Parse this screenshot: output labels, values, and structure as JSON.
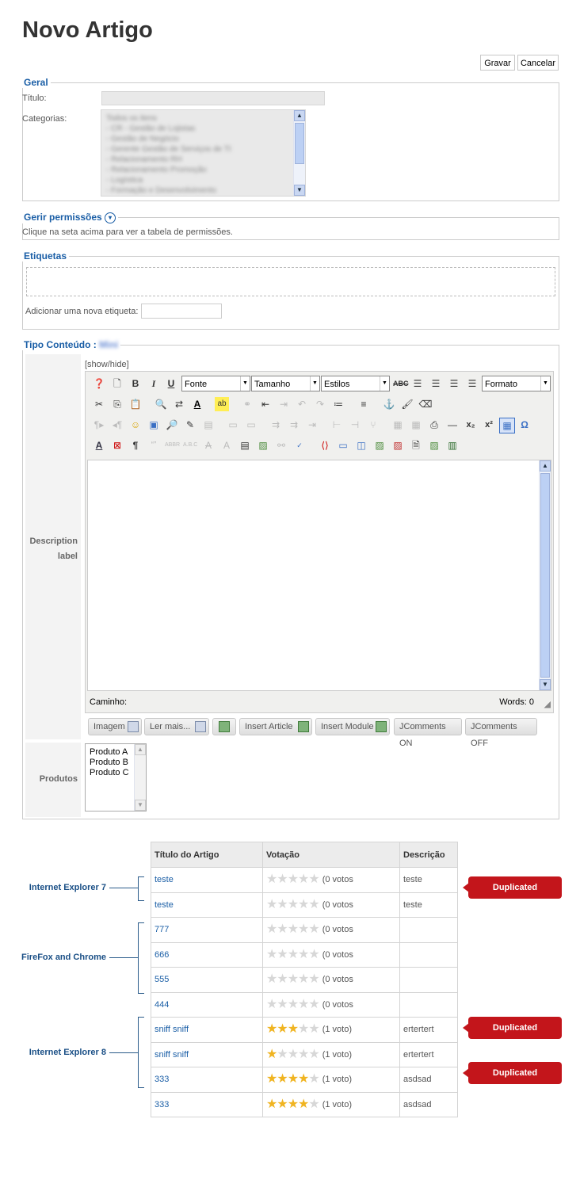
{
  "page": {
    "title": "Novo Artigo"
  },
  "actions": {
    "save": "Gravar",
    "cancel": "Cancelar"
  },
  "geral": {
    "legend": "Geral",
    "title_label": "Título:",
    "categories_label": "Categorias:",
    "categories": [
      "Todos os itens",
      "- CR - Gestão de Lojistas",
      "- Gestão de Negócio",
      "- Gerente Gestão de Serviços de TI",
      "- Relacionamento RH",
      "- Relacionamento Promoção",
      "- Logística",
      "- Formação e Desenvolvimento"
    ]
  },
  "permissions": {
    "legend": "Gerir permissões",
    "hint": "Clique na seta acima para ver a tabela de permissões.",
    "toggle_icon": "chevron-down-circle-icon"
  },
  "tags": {
    "legend": "Etiquetas",
    "add_label": "Adicionar uma nova etiqueta:",
    "add_value": ""
  },
  "content": {
    "legend": "Tipo Conteúdo :",
    "legend_value": "Mini",
    "description_label": "Description label",
    "showhide": "[show/hide]",
    "editor": {
      "font": "Fonte",
      "size": "Tamanho",
      "styles": "Estilos",
      "format": "Formato",
      "path_label": "Caminho:",
      "words_label": "Words: 0"
    },
    "buttons": [
      "Imagem",
      "Ler mais...",
      "",
      "Insert Article",
      "Insert Module",
      "JComments ON",
      "JComments OFF"
    ],
    "products_label": "Produtos",
    "products": [
      "Produto A",
      "Produto B",
      "Produto C"
    ]
  },
  "results": {
    "headers": [
      "Título do Artigo",
      "Votação",
      "Descrição"
    ],
    "rows": [
      {
        "title": "teste",
        "rating": 0,
        "votes": "(0 votos",
        "desc": "teste"
      },
      {
        "title": "teste",
        "rating": 0,
        "votes": "(0 votos",
        "desc": "teste"
      },
      {
        "title": "777",
        "rating": 0,
        "votes": "(0 votos",
        "desc": ""
      },
      {
        "title": "666",
        "rating": 0,
        "votes": "(0 votos",
        "desc": ""
      },
      {
        "title": "555",
        "rating": 0,
        "votes": "(0 votos",
        "desc": ""
      },
      {
        "title": "444",
        "rating": 0,
        "votes": "(0 votos",
        "desc": ""
      },
      {
        "title": "sniff sniff",
        "rating": 3,
        "votes": "(1 voto)",
        "desc": "ertertert"
      },
      {
        "title": "sniff sniff",
        "rating": 1,
        "votes": "(1 voto)",
        "desc": "ertertert"
      },
      {
        "title": "333",
        "rating": 4,
        "votes": "(1 voto)",
        "desc": "asdsad"
      },
      {
        "title": "333",
        "rating": 4,
        "votes": "(1 voto)",
        "desc": "asdsad"
      }
    ],
    "groups": [
      "Internet Explorer 7",
      "FireFox and Chrome",
      "Internet Explorer 8"
    ],
    "duplicate_label": "Duplicated"
  },
  "colors": {
    "link": "#1a5ea6",
    "duplicate": "#c3151b",
    "star": "#f0b421"
  }
}
